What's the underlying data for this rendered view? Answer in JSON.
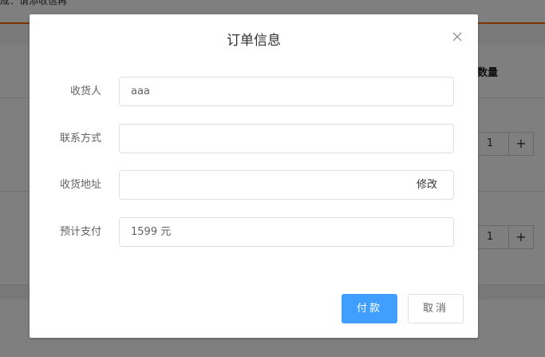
{
  "background": {
    "topbar_text": "成：请添收信再",
    "qty_header": "数量",
    "rows": [
      {
        "qty": "1",
        "plus": "+"
      },
      {
        "qty": "1",
        "plus": "+"
      }
    ]
  },
  "dialog": {
    "title": "订单信息",
    "close_icon": "close-icon",
    "fields": {
      "receiver": {
        "label": "收货人",
        "value": "aaa",
        "placeholder": ""
      },
      "contact": {
        "label": "联系方式",
        "value": "",
        "placeholder": ""
      },
      "address": {
        "label": "收货地址",
        "value": "",
        "edit_label": "修改"
      },
      "payment": {
        "label": "预计支付",
        "value": "1599 元"
      }
    },
    "buttons": {
      "pay": "付款",
      "cancel": "取消"
    }
  },
  "colors": {
    "primary": "#409eff",
    "accent_orange": "#ff6700",
    "overlay": "rgba(0,0,0,0.5)"
  }
}
